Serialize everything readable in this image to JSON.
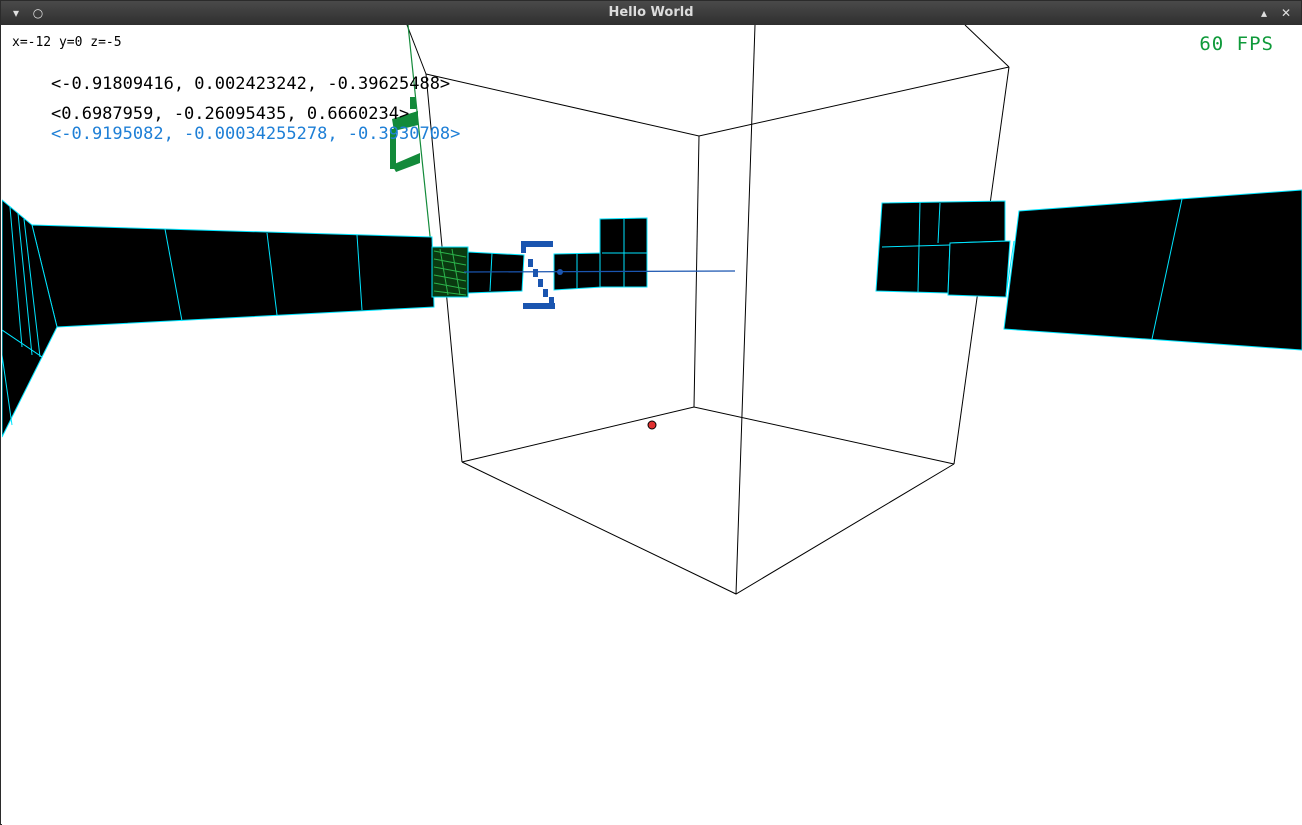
{
  "window": {
    "title": "Hello World",
    "menu_icon": "chevron-down-icon",
    "pin_icon": "circle-icon",
    "maximize_icon": "chevron-up-icon",
    "close_icon": "close-icon"
  },
  "hud": {
    "position": "x=-12 y=0 z=-5",
    "fps": "60 FPS",
    "vectors": [
      "<-0.91809416, 0.002423242, -0.39625488>",
      "<0.6987959, -0.26095435, 0.6660234>",
      "<-0.9195082, -0.00034255278, -0.3930708>"
    ]
  },
  "colors": {
    "fps": "#0f9a3a",
    "vector_highlight": "#1e7fd6",
    "edge": "#00e5ff",
    "marker": "#e03030",
    "axis_green": "#138a3a",
    "axis_blue": "#1a55b0"
  }
}
